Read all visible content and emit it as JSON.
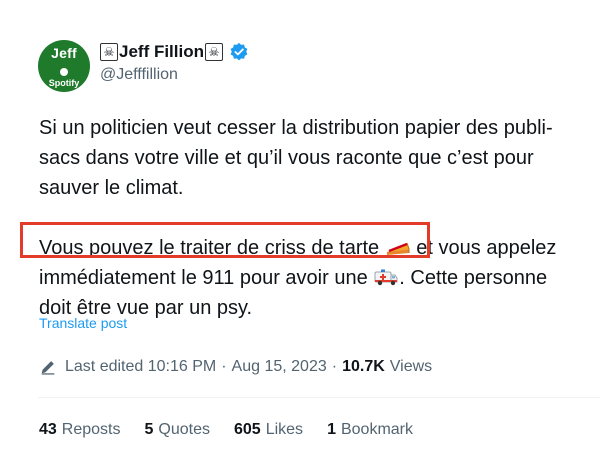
{
  "author": {
    "name": "Jeff Fillion",
    "handle": "@Jefffillion",
    "avatar_text_top": "Jeff",
    "avatar_text_bottom": "Spotify",
    "name_prefix_icon": "skull-crossbones-icon",
    "name_suffix_icon": "skull-crossbones-icon",
    "verified_icon": "verified-badge-icon",
    "avatar_color": "#1f7a2c"
  },
  "tweet": {
    "paragraph1": "Si un politicien veut cesser la distribution papier des publi-sacs dans votre ville et qu’il vous raconte que c’est pour sauver le climat.",
    "paragraph2_part1": "Vous pouvez le traiter de criss de tarte ",
    "pie_icon": "pie-emoji-icon",
    "paragraph2_part2": " et vous appelez immédiatement le 911 pour avoir une ",
    "ambulance_icon": "ambulance-emoji-icon",
    "paragraph2_part3": ". Cette personne doit être vue par un psy.",
    "highlight_color": "#e23b29"
  },
  "translate_label": "Translate post",
  "meta": {
    "edit_icon": "pencil-icon",
    "edited_label": "Last edited 10:16 PM",
    "separator1": "·",
    "date": "Aug 15, 2023",
    "separator2": "·",
    "views_count": "10.7K",
    "views_label": "Views"
  },
  "stats": {
    "reposts_count": "43",
    "reposts_label": "Reposts",
    "quotes_count": "5",
    "quotes_label": "Quotes",
    "likes_count": "605",
    "likes_label": "Likes",
    "bookmarks_count": "1",
    "bookmarks_label": "Bookmark"
  },
  "colors": {
    "text": "#0f1419",
    "secondary": "#536471",
    "link": "#1d9bf0",
    "verified": "#1d9bf0"
  }
}
